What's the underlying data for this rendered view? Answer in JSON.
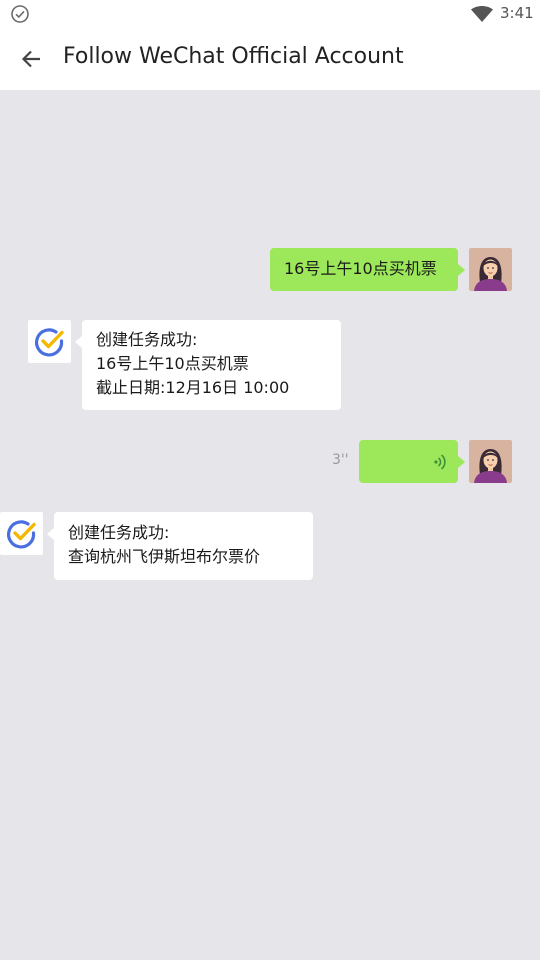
{
  "status_bar": {
    "time": "3:41"
  },
  "app_bar": {
    "title": "Follow WeChat Official Account"
  },
  "messages": [
    {
      "sender": "user",
      "type": "text",
      "text": "16号上午10点买机票"
    },
    {
      "sender": "bot",
      "type": "text",
      "lines": [
        "创建任务成功:",
        "16号上午10点买机票",
        "截止日期:12月16日 10:00"
      ]
    },
    {
      "sender": "user",
      "type": "voice",
      "duration": "3''"
    },
    {
      "sender": "bot",
      "type": "text",
      "lines": [
        "创建任务成功:",
        "查询杭州飞伊斯坦布尔票价"
      ]
    }
  ],
  "colors": {
    "chat_background": "#e6e6ea",
    "user_bubble": "#9de85a",
    "bot_bubble": "#ffffff",
    "check_blue": "#4a6fe0",
    "check_yellow": "#f5b800",
    "voice_icon": "#3f8f3a"
  },
  "icons": [
    "status-check-icon",
    "wifi-icon",
    "back-arrow-icon",
    "user-avatar",
    "bot-check-avatar",
    "voice-wave-icon"
  ]
}
